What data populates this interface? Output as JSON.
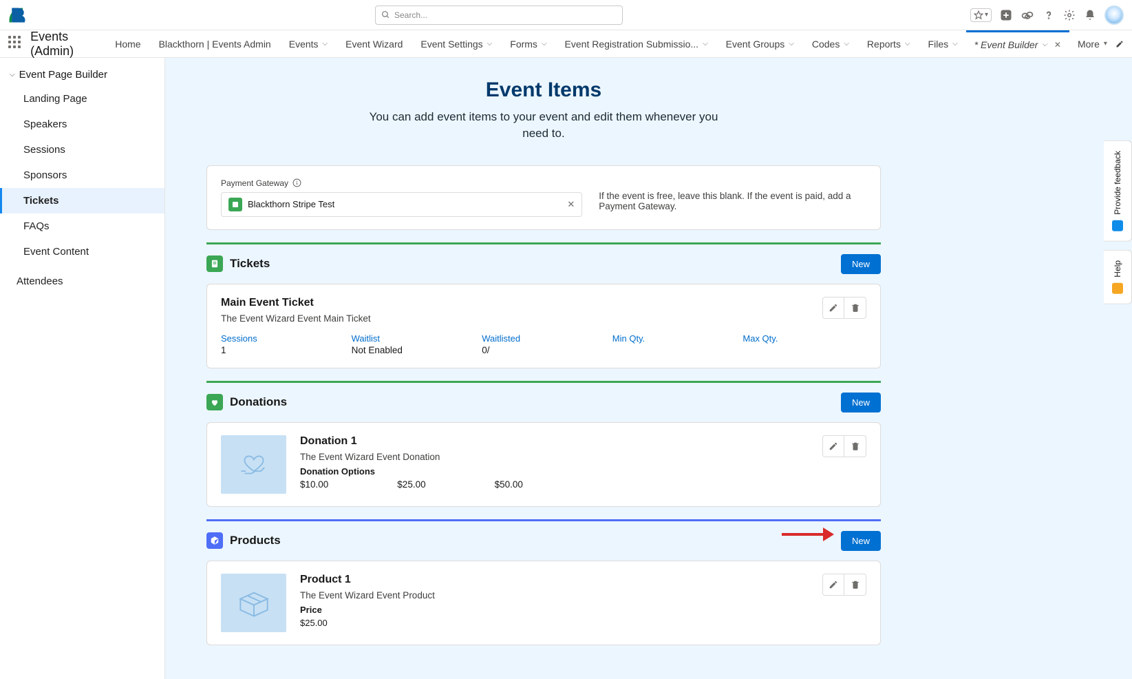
{
  "search_placeholder": "Search...",
  "app_name": "Events (Admin)",
  "nav": [
    {
      "label": "Home",
      "drop": false
    },
    {
      "label": "Blackthorn | Events Admin",
      "drop": false
    },
    {
      "label": "Events",
      "drop": true
    },
    {
      "label": "Event Wizard",
      "drop": false
    },
    {
      "label": "Event Settings",
      "drop": true
    },
    {
      "label": "Forms",
      "drop": true
    },
    {
      "label": "Event Registration Submissio...",
      "drop": true
    },
    {
      "label": "Event Groups",
      "drop": true
    },
    {
      "label": "Codes",
      "drop": true
    },
    {
      "label": "Reports",
      "drop": true
    },
    {
      "label": "Files",
      "drop": true
    }
  ],
  "special_tab": "* Event Builder",
  "more_label": "More",
  "sidebar": {
    "group": "Event Page Builder",
    "items": [
      "Landing Page",
      "Speakers",
      "Sessions",
      "Sponsors",
      "Tickets",
      "FAQs",
      "Event Content"
    ],
    "active_index": 4,
    "attendees": "Attendees"
  },
  "page": {
    "title": "Event Items",
    "subtitle": "You can add event items to your event and edit them whenever you need to."
  },
  "payment_gateway": {
    "label": "Payment Gateway",
    "value": "Blackthorn Stripe Test",
    "hint": "If the event is free, leave this blank. If the event is paid, add a Payment Gateway."
  },
  "new_label": "New",
  "sections": {
    "tickets": {
      "title": "Tickets",
      "item": {
        "name": "Main Event Ticket",
        "desc": "The Event Wizard Event Main Ticket",
        "cols": [
          {
            "label": "Sessions",
            "value": "1"
          },
          {
            "label": "Waitlist",
            "value": "Not Enabled"
          },
          {
            "label": "Waitlisted",
            "value": "0/"
          },
          {
            "label": "Min Qty.",
            "value": ""
          },
          {
            "label": "Max Qty.",
            "value": ""
          }
        ]
      }
    },
    "donations": {
      "title": "Donations",
      "item": {
        "name": "Donation 1",
        "desc": "The Event Wizard Event Donation",
        "opts_label": "Donation Options",
        "opts": [
          "$10.00",
          "$25.00",
          "$50.00"
        ]
      }
    },
    "products": {
      "title": "Products",
      "item": {
        "name": "Product 1",
        "desc": "The Event Wizard Event Product",
        "price_label": "Price",
        "price": "$25.00"
      }
    }
  },
  "rail": {
    "feedback": "Provide feedback",
    "help": "Help"
  }
}
